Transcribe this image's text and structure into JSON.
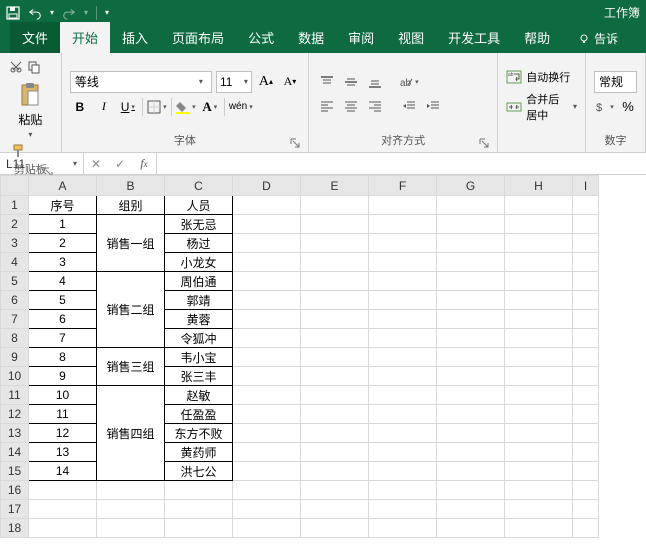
{
  "titlebar": {
    "doc_title": "工作簿"
  },
  "tabs": {
    "file": "文件",
    "home": "开始",
    "insert": "插入",
    "layout": "页面布局",
    "formulas": "公式",
    "data": "数据",
    "review": "审阅",
    "view": "视图",
    "dev": "开发工具",
    "help": "帮助",
    "tellme": "告诉"
  },
  "ribbon": {
    "clipboard": {
      "label": "剪贴板",
      "paste": "粘贴"
    },
    "font": {
      "label": "字体",
      "name": "等线",
      "size": "11",
      "bold": "B",
      "italic": "I",
      "underline": "U",
      "wen": "wén"
    },
    "align": {
      "label": "对齐方式"
    },
    "wrap": {
      "wrap": "自动换行",
      "merge": "合并后居中"
    },
    "number": {
      "label": "数字",
      "format": "常规",
      "percent": "%",
      "comma": ","
    }
  },
  "namebox": {
    "ref": "L11"
  },
  "columns": [
    "A",
    "B",
    "C",
    "D",
    "E",
    "F",
    "G",
    "H",
    "I"
  ],
  "rowcount": 18,
  "sheet": {
    "header": {
      "a": "序号",
      "b": "组别",
      "c": "人员"
    },
    "groups": [
      {
        "name": "销售一组",
        "rows": [
          1,
          2,
          3
        ],
        "members": [
          "张无忌",
          "杨过",
          "小龙女"
        ]
      },
      {
        "name": "销售二组",
        "rows": [
          4,
          5,
          6,
          7
        ],
        "members": [
          "周伯通",
          "郭靖",
          "黄蓉",
          "令狐冲"
        ]
      },
      {
        "name": "销售三组",
        "rows": [
          8,
          9
        ],
        "members": [
          "韦小宝",
          "张三丰"
        ]
      },
      {
        "name": "销售四组",
        "rows": [
          10,
          11,
          12,
          13,
          14
        ],
        "members": [
          "赵敏",
          "任盈盈",
          "东方不败",
          "黄药师",
          "洪七公"
        ]
      }
    ]
  }
}
